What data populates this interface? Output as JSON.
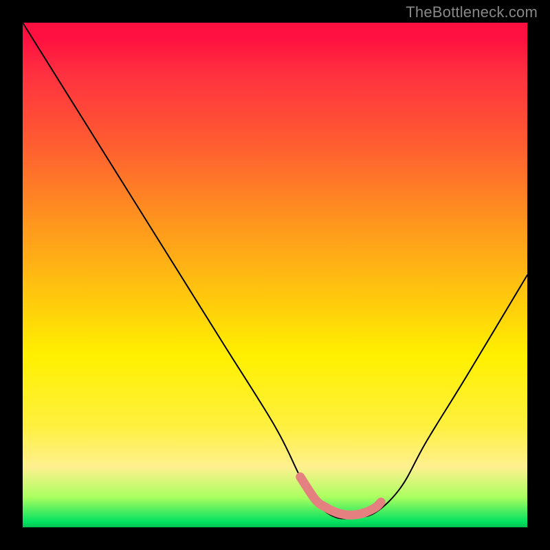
{
  "watermark": "TheBottleneck.com",
  "chart_data": {
    "type": "line",
    "title": "",
    "xlabel": "",
    "ylabel": "",
    "xlim": [
      0,
      100
    ],
    "ylim": [
      0,
      100
    ],
    "x": [
      0,
      10,
      20,
      30,
      40,
      50,
      55,
      58,
      62,
      66,
      70,
      75,
      80,
      88,
      100
    ],
    "values": [
      100,
      84,
      68,
      52,
      36,
      20,
      10,
      5,
      2,
      2,
      3,
      8,
      17,
      30,
      50
    ],
    "highlight_segment": {
      "x": [
        55,
        58,
        60,
        62,
        64,
        66,
        68,
        70,
        71
      ],
      "values": [
        10,
        5.5,
        4,
        3,
        2.5,
        2.5,
        3,
        4,
        5
      ]
    },
    "gradient_stops": [
      {
        "pos": 0.0,
        "color": "#ff1040"
      },
      {
        "pos": 0.25,
        "color": "#ff6030"
      },
      {
        "pos": 0.55,
        "color": "#ffe000"
      },
      {
        "pos": 0.88,
        "color": "#ffff90"
      },
      {
        "pos": 0.96,
        "color": "#80ff60"
      },
      {
        "pos": 1.0,
        "color": "#00c050"
      }
    ]
  }
}
